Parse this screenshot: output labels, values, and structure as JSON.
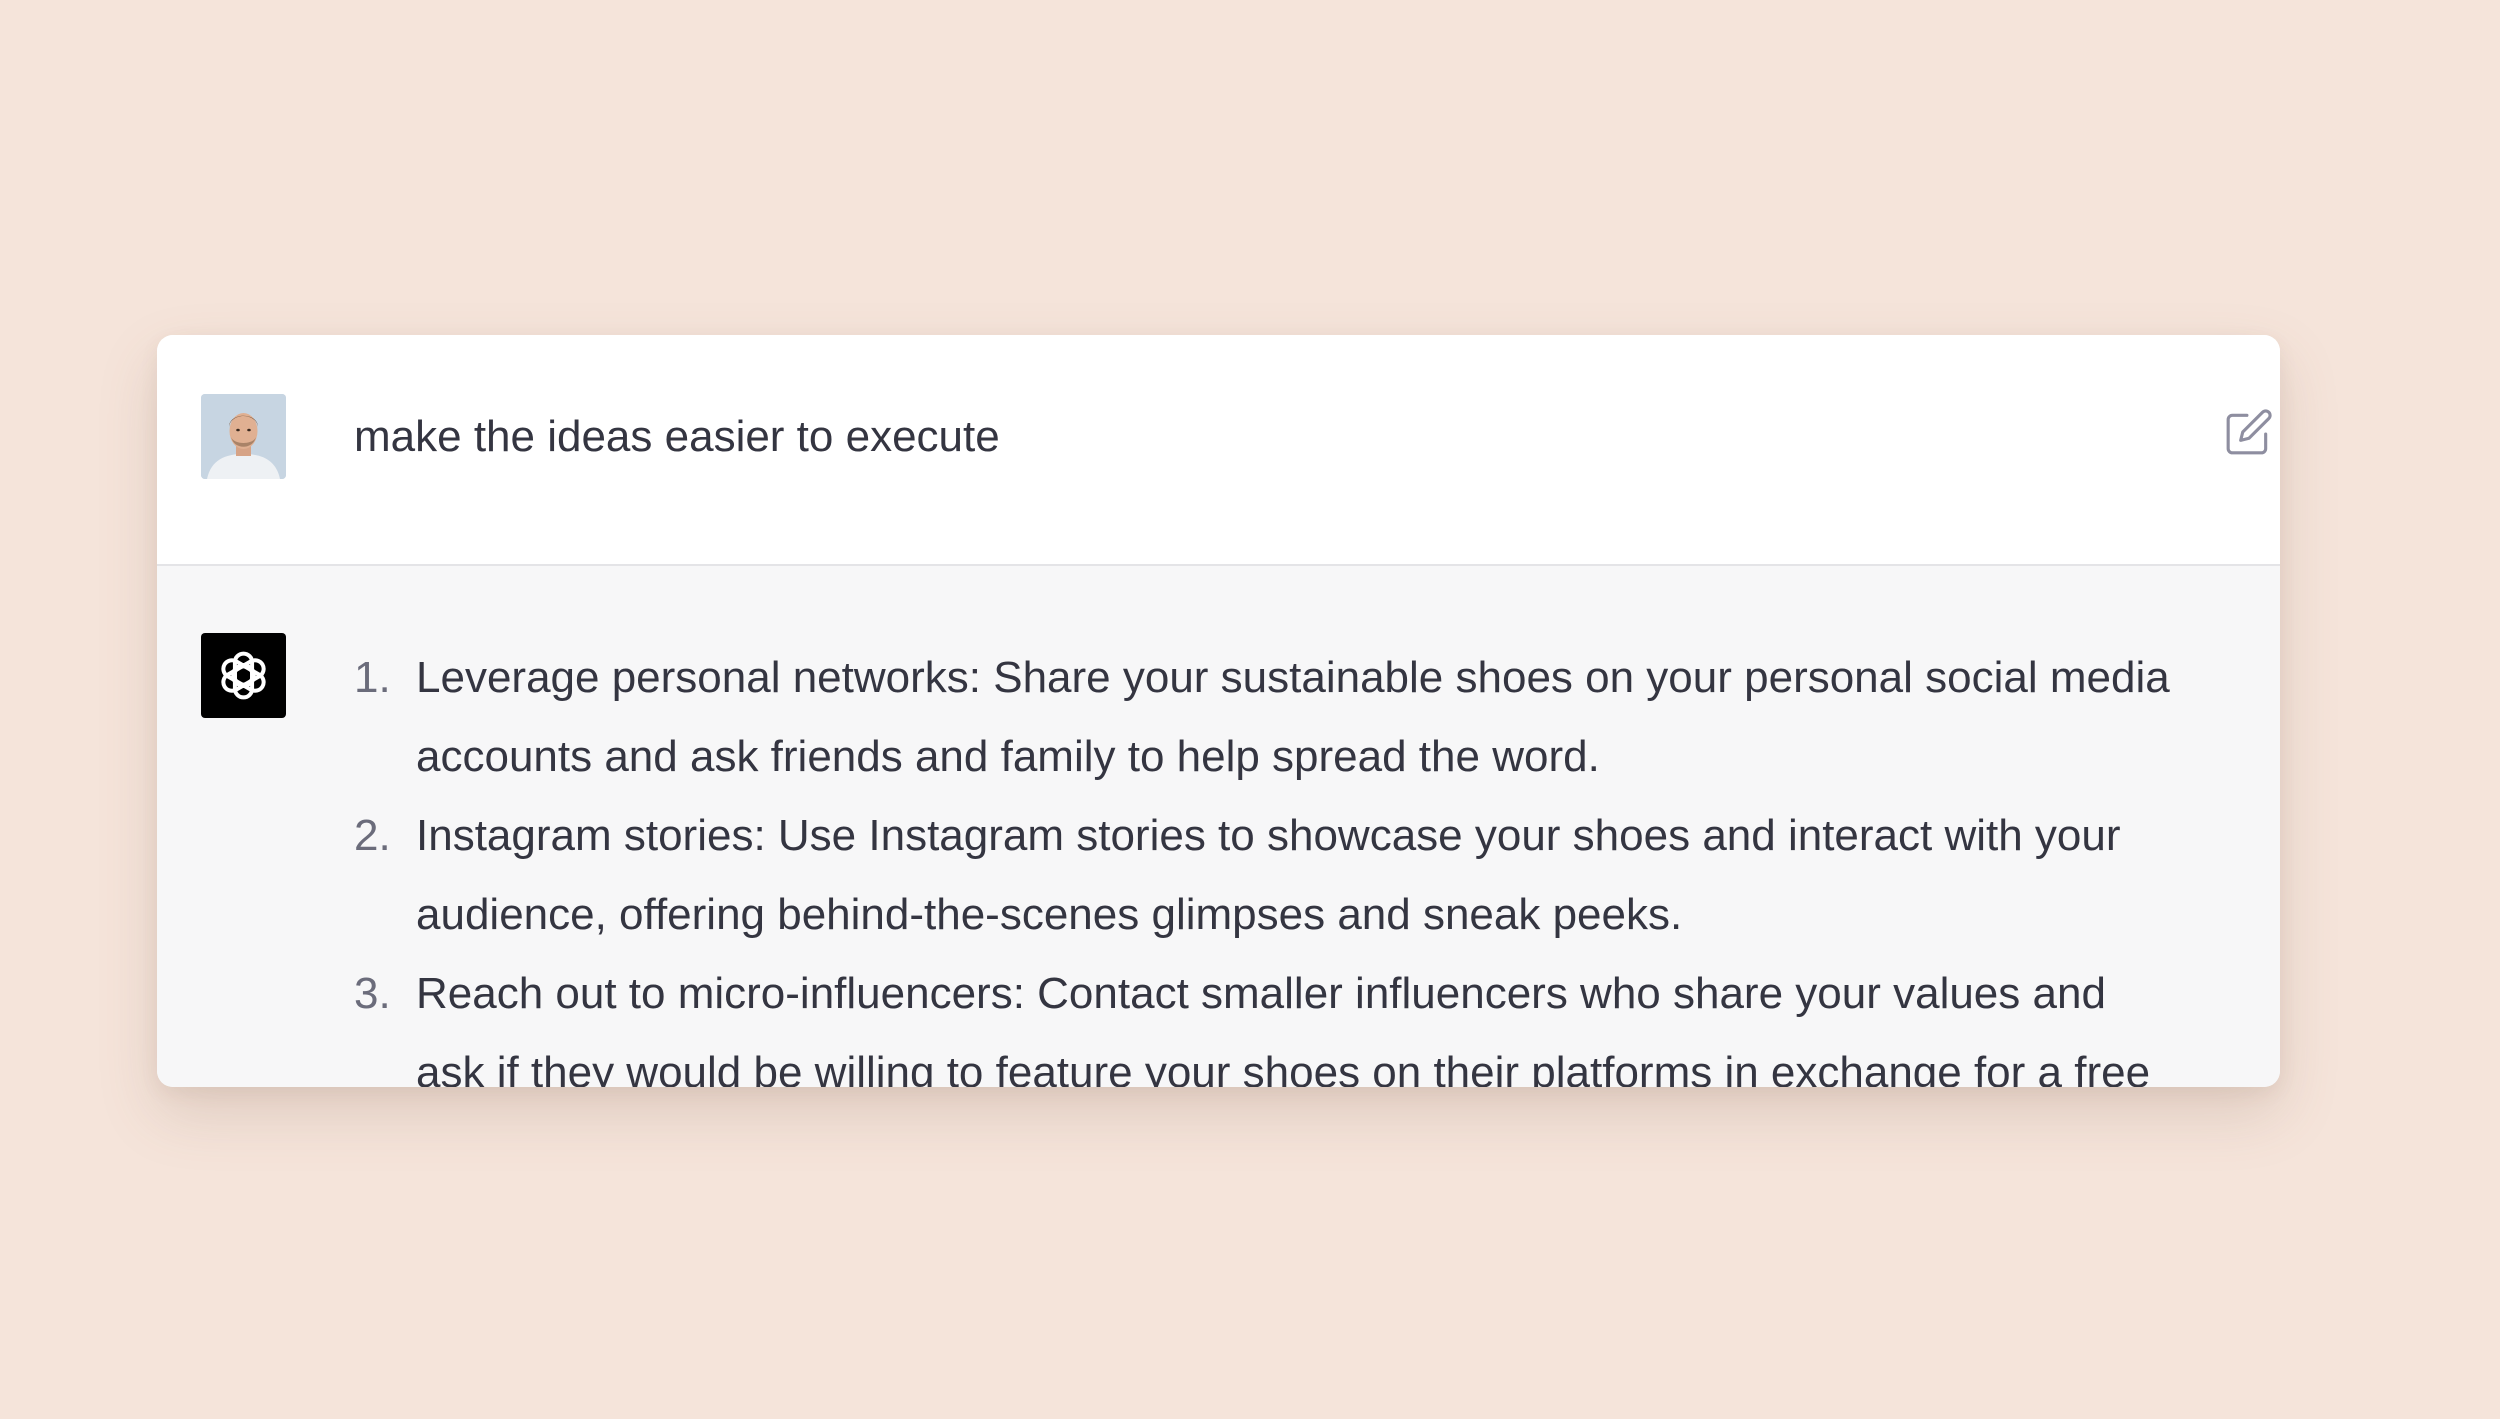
{
  "colors": {
    "page_background": "#f5e4da",
    "user_row_background": "#ffffff",
    "assistant_row_background": "#f7f7f8",
    "text": "#343541",
    "muted": "#6b6c7b"
  },
  "user_message": {
    "avatar_icon": "user-avatar",
    "text": "make the ideas easier to execute",
    "edit_icon": "edit-icon"
  },
  "assistant_message": {
    "avatar_icon": "openai-logo-icon",
    "items": [
      {
        "number": "1.",
        "text": "Leverage personal networks: Share your sustainable shoes on your personal social media accounts and ask friends and family to help spread the word."
      },
      {
        "number": "2.",
        "text": "Instagram stories: Use Instagram stories to showcase your shoes and interact with your audience, offering behind-the-scenes glimpses and sneak peeks."
      },
      {
        "number": "3.",
        "text": "Reach out to micro-influencers: Contact smaller influencers who share your values and ask if they would be willing to feature your shoes on their platforms in exchange for a free"
      }
    ]
  }
}
